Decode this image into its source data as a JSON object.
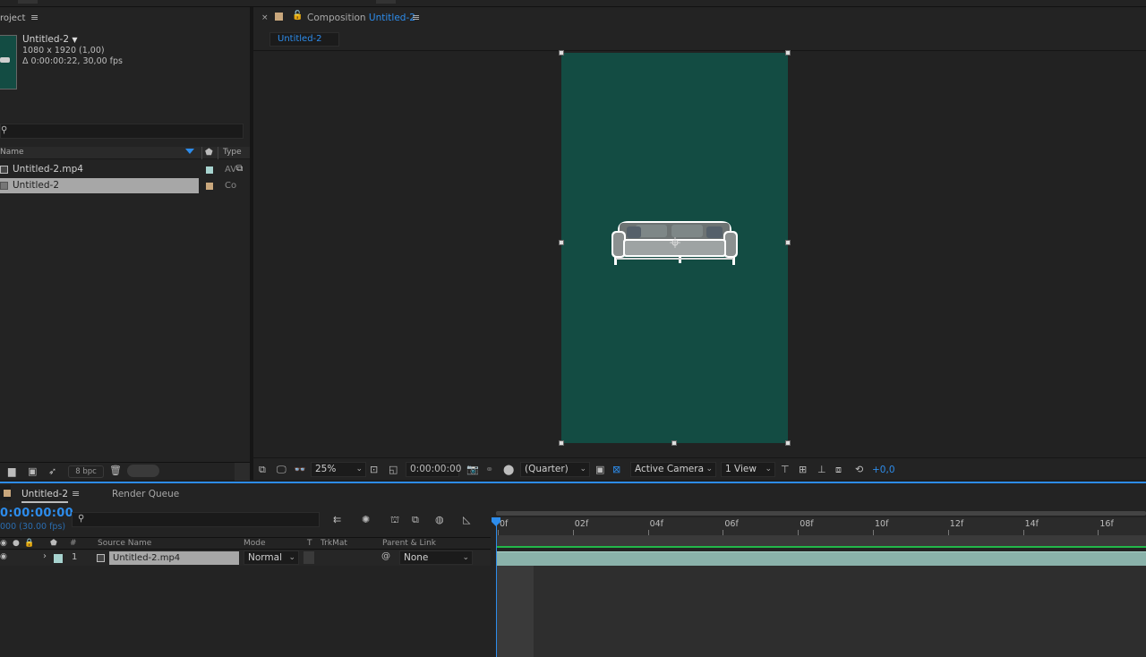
{
  "project": {
    "panel_title": "roject",
    "comp_name": "Untitled-2",
    "comp_size": "1080 x 1920 (1,00)",
    "comp_duration": "Δ 0:00:00:22, 30,00 fps",
    "search_glyph": "⚲",
    "columns": {
      "name": "Name",
      "type": "Type"
    },
    "items": [
      {
        "name": "Untitled-2.mp4",
        "type": "AV",
        "color": "#a7d3cf",
        "selected": false
      },
      {
        "name": "Untitled-2",
        "type": "Co",
        "color": "#c9a77c",
        "selected": true
      }
    ],
    "bpc": "8 bpc"
  },
  "composition": {
    "tab_prefix": "Composition",
    "tab_name": "Untitled-2",
    "subtab": "Untitled-2",
    "canvas_color": "#134c43",
    "toolbar": {
      "zoom": "25%",
      "timecode": "0:00:00:00",
      "resolution": "(Quarter)",
      "camera": "Active Camera",
      "views": "1 View",
      "exposure": "+0,0"
    }
  },
  "timeline": {
    "tab_name": "Untitled-2",
    "render_queue": "Render Queue",
    "timecode": "0:00:00:00",
    "fps": "000 (30.00 fps)",
    "columns": {
      "source_name": "Source Name",
      "mode": "Mode",
      "t": "T",
      "trkmat": "TrkMat",
      "parent": "Parent & Link"
    },
    "layer": {
      "index": "1",
      "name": "Untitled-2.mp4",
      "mode": "Normal",
      "parent": "None",
      "label_color": "#a7d3cf"
    },
    "ruler": [
      "0f",
      "02f",
      "04f",
      "06f",
      "08f",
      "10f",
      "12f",
      "14f",
      "16f"
    ]
  }
}
